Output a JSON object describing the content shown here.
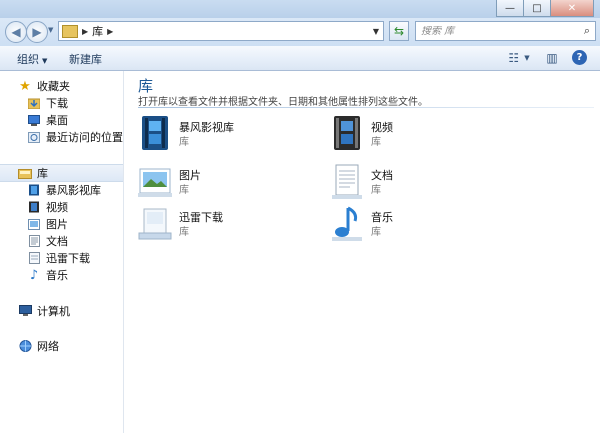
{
  "address": {
    "location": "库"
  },
  "search": {
    "placeholder": "搜索 库"
  },
  "toolbar": {
    "organize": "组织",
    "new_library": "新建库"
  },
  "sidebar": {
    "favorites": "收藏夹",
    "downloads": "下载",
    "desktop": "桌面",
    "recent": "最近访问的位置",
    "libraries": "库",
    "lib_items": [
      "暴风影视库",
      "视频",
      "图片",
      "文档",
      "迅雷下载",
      "音乐"
    ],
    "computer": "计算机",
    "network": "网络"
  },
  "main": {
    "title": "库",
    "description": "打开库以查看文件并根据文件夹、日期和其他属性排列这些文件。",
    "items": [
      {
        "name": "暴风影视库",
        "sub": "库"
      },
      {
        "name": "视频",
        "sub": "库"
      },
      {
        "name": "图片",
        "sub": "库"
      },
      {
        "name": "文档",
        "sub": "库"
      },
      {
        "name": "迅雷下载",
        "sub": "库"
      },
      {
        "name": "音乐",
        "sub": "库"
      }
    ]
  },
  "icons": [
    "back-icon",
    "forward-icon",
    "library-folder-icon",
    "refresh-icon",
    "search-icon",
    "views-icon",
    "preview-pane-icon",
    "help-icon",
    "star-icon",
    "downloads-folder-icon",
    "desktop-icon",
    "recent-places-icon",
    "computer-icon",
    "network-icon",
    "video-library-icon",
    "pictures-library-icon",
    "documents-library-icon",
    "music-note-icon"
  ],
  "colors": {
    "accent": "#1e5a96",
    "selection": "#dde8f6"
  }
}
